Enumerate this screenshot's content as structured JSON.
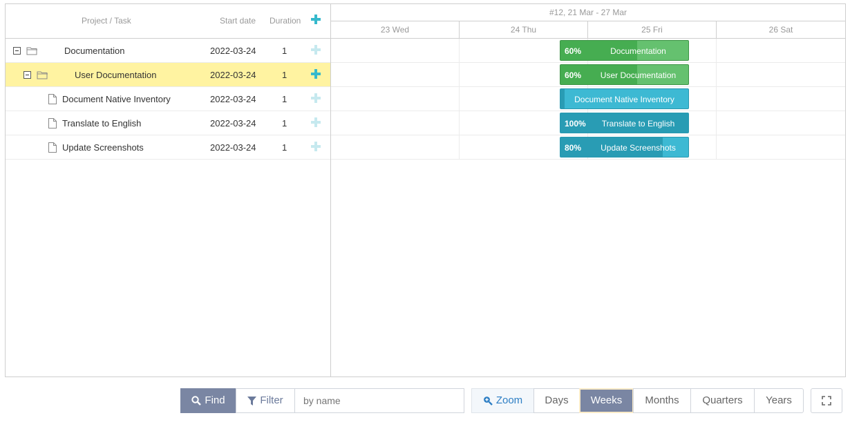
{
  "grid": {
    "headers": {
      "name": "Project / Task",
      "start": "Start date",
      "duration": "Duration"
    },
    "rows": [
      {
        "name": "Documentation",
        "start": "2022-03-24",
        "duration": "1"
      },
      {
        "name": "User Documentation",
        "start": "2022-03-24",
        "duration": "1"
      },
      {
        "name": "Document Native Inventory",
        "start": "2022-03-24",
        "duration": "1"
      },
      {
        "name": "Translate to English",
        "start": "2022-03-24",
        "duration": "1"
      },
      {
        "name": "Update Screenshots",
        "start": "2022-03-24",
        "duration": "1"
      }
    ]
  },
  "timeline": {
    "week_label": "#12, 21 Mar - 27 Mar",
    "days": [
      "23 Wed",
      "24 Thu",
      "25 Fri",
      "26 Sat"
    ],
    "bars": [
      {
        "label": "Documentation",
        "progress_text": "60%",
        "progress": 0.6
      },
      {
        "label": "User Documentation",
        "progress_text": "60%",
        "progress": 0.6
      },
      {
        "label": "Document Native Inventory",
        "progress_text": "",
        "progress": 0.03
      },
      {
        "label": "Translate to English",
        "progress_text": "100%",
        "progress": 1.0
      },
      {
        "label": "Update Screenshots",
        "progress_text": "80%",
        "progress": 0.8
      }
    ]
  },
  "toolbar": {
    "find": "Find",
    "filter": "Filter",
    "search_placeholder": "by name",
    "zoom": "Zoom",
    "scales": [
      "Days",
      "Weeks",
      "Months",
      "Quarters",
      "Years"
    ],
    "active_scale": "Weeks"
  },
  "colors": {
    "project_bar": "#65c16f",
    "task_bar": "#3db9d3",
    "selected_row": "#fff3a1",
    "accent": "#7a86a3"
  }
}
